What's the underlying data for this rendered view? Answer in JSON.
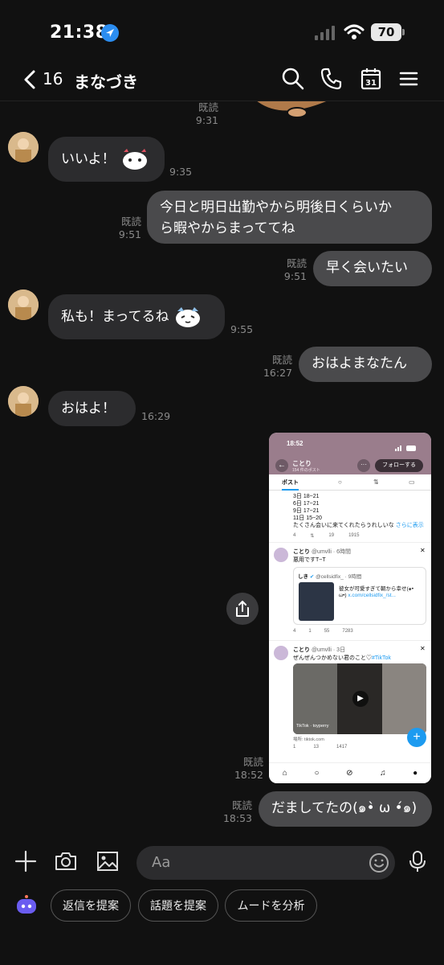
{
  "status": {
    "time": "21:38",
    "battery": "70"
  },
  "header": {
    "unread_count": "16",
    "name": "まなづき"
  },
  "messages": {
    "m0_read": "既読",
    "m0_time": "9:31",
    "m1_text": "いいよ！",
    "m1_time": "9:35",
    "m2_text_1": "今日と明日出勤やから明後日くらいか",
    "m2_text_2": "ら暇やからまっててね",
    "m2_read": "既読",
    "m2_time": "9:51",
    "m3_text": "早く会いたい",
    "m3_read": "既読",
    "m3_time": "9:51",
    "m4_text": "私も！まってるね",
    "m4_time": "9:55",
    "m5_text": "おはよまなたん",
    "m5_read": "既読",
    "m5_time": "16:27",
    "m6_text": "おはよ！",
    "m6_time": "16:29",
    "m7_read": "既読",
    "m7_time": "18:52",
    "m8_text": "だましてたの(๑•̀ ω •́๑)",
    "m8_read": "既読",
    "m8_time": "18:53"
  },
  "shot": {
    "time": "18:52",
    "profile_name": "ことり",
    "profile_posts": "154 件のポスト",
    "follow": "フォローする",
    "tab_posts": "ポスト",
    "schedule": [
      "3日 18~21",
      "6日 17~21",
      "9日 17~21",
      "11日 15~20"
    ],
    "schedule_note": "たくさん会いに来てくれたらうれしいな",
    "more": "さらに表示",
    "s1": {
      "reply": "4",
      "like": "19",
      "views": "1915"
    },
    "p1_name": "ことり",
    "p1_handle": "@umvlli · 6時間",
    "p1_text": "悪用ですT~T",
    "q_name": "しき",
    "q_handle": "@cellsidfix_ · 9時間",
    "q_text": "彼女が可愛すぎて朝から幸せ(๑•",
    "q_text2": "ω•)",
    "q_link": "x.com/cellsidfix_/st...",
    "s2": {
      "reply": "4",
      "rt": "1",
      "like": "55",
      "views": "7283"
    },
    "p2_name": "ことり",
    "p2_handle": "@umvlli · 3日",
    "p2_text": "ぜんぜんつかめない君のこと♡",
    "p2_tag": "#TikTok",
    "tiktok_label": "TikTok · toyperry",
    "source": "場所: tiktok.com",
    "s3": {
      "rt": "1",
      "like": "13",
      "views": "1417"
    }
  },
  "input": {
    "placeholder": "Aa"
  },
  "chips": {
    "reply": "返信を提案",
    "topic": "話題を提案",
    "mood": "ムードを分析"
  },
  "colors": {
    "background": "#111111",
    "bubble_in": "#2c2c2e",
    "bubble_out": "#4a4a4c",
    "accent": "#2b8df0",
    "x_profile": "#9a7d8c"
  }
}
